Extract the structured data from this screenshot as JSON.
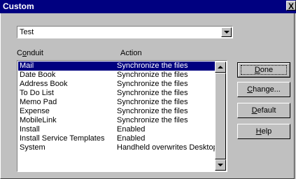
{
  "window": {
    "title": "Custom",
    "close_label": "X"
  },
  "handheld_select": {
    "value": "Test"
  },
  "columns": {
    "conduit_pre": "C",
    "conduit_key": "o",
    "conduit_post": "nduit",
    "action": "Action"
  },
  "conduits": [
    {
      "name": "Mail",
      "action": "Synchronize the files",
      "selected": true
    },
    {
      "name": "Date Book",
      "action": "Synchronize the files"
    },
    {
      "name": "Address Book",
      "action": "Synchronize the files"
    },
    {
      "name": "To Do List",
      "action": "Synchronize the files"
    },
    {
      "name": "Memo Pad",
      "action": "Synchronize the files"
    },
    {
      "name": "Expense",
      "action": "Synchronize the files"
    },
    {
      "name": "MobileLink",
      "action": "Synchronize the files"
    },
    {
      "name": "Install",
      "action": "Enabled"
    },
    {
      "name": "Install Service Templates",
      "action": "Enabled"
    },
    {
      "name": "System",
      "action": "Handheld overwrites Desktop"
    }
  ],
  "buttons": {
    "done": {
      "key": "D",
      "rest": "one"
    },
    "change": {
      "key": "C",
      "rest": "hange..."
    },
    "default": {
      "key": "D",
      "rest": "efault"
    },
    "help": {
      "key": "H",
      "rest": "elp"
    }
  },
  "colors": {
    "titlebar": "#000080",
    "face": "#c0c0c0",
    "selection": "#000080"
  }
}
